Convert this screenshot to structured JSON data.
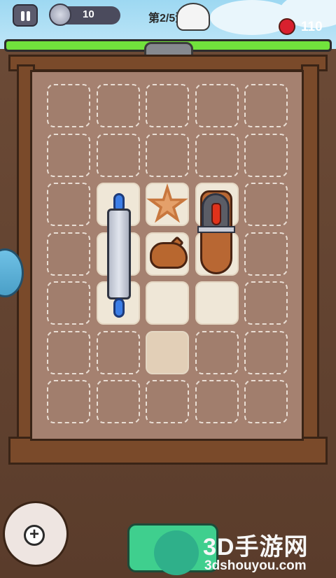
{
  "hud": {
    "coins": "10",
    "wave": "第2/5波",
    "lives": "110",
    "health_fraction": 1.0
  },
  "grid": {
    "rows": 7,
    "cols": 5,
    "lit_cells": [
      [
        2,
        1
      ],
      [
        2,
        2
      ],
      [
        2,
        3
      ],
      [
        3,
        1
      ],
      [
        3,
        2
      ],
      [
        3,
        3
      ],
      [
        4,
        1
      ],
      [
        4,
        2
      ],
      [
        4,
        3
      ]
    ],
    "half_cells": [
      [
        5,
        2
      ]
    ]
  },
  "items": [
    {
      "name": "rolling-pin",
      "icon": "rolling-pin-icon"
    },
    {
      "name": "starfish-cookie",
      "icon": "star-cookie-icon"
    },
    {
      "name": "pig-cookie",
      "icon": "pig-cookie-icon"
    },
    {
      "name": "chili-board",
      "icon": "chili-board-icon"
    }
  ],
  "buttons": {
    "add_label": "+"
  },
  "watermark": {
    "title": "3D手游网",
    "url": "3dshouyou.com"
  },
  "colors": {
    "health": "#71e23c",
    "heart": "#d8202e",
    "board": "#a58170",
    "start": "#3fcf8e"
  }
}
